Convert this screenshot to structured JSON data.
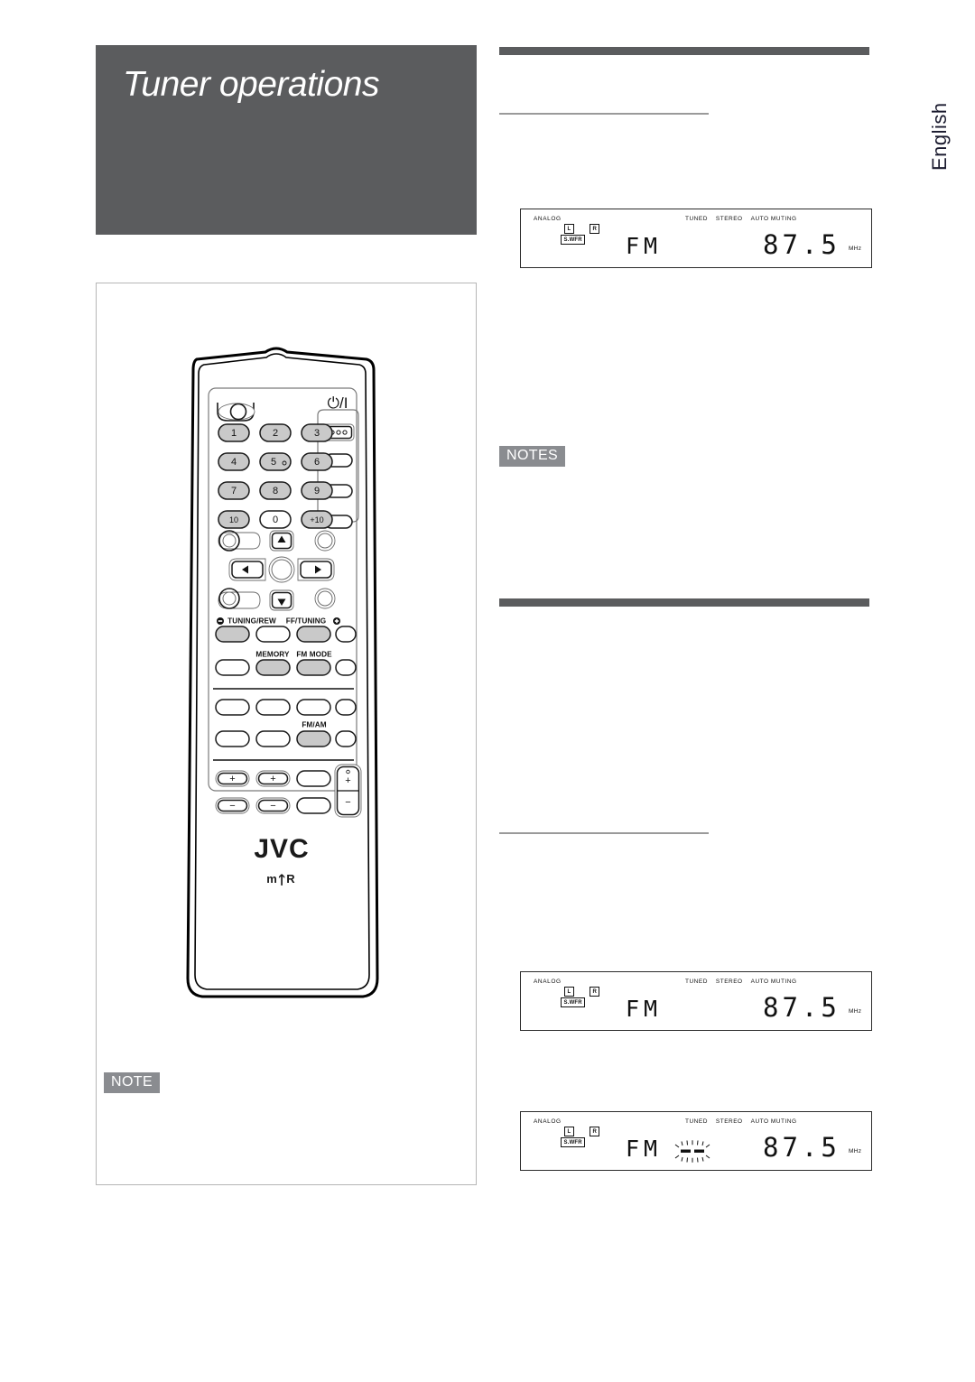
{
  "page": {
    "title": "Tuner operations",
    "language_tab": "English"
  },
  "badges": {
    "note": "NOTE",
    "notes": "NOTES"
  },
  "remote": {
    "brand": "JVC",
    "sub_brand": "mBR",
    "power_symbol": "⏻/I",
    "keypad": [
      "1",
      "2",
      "3",
      "4",
      "5",
      "6",
      "7",
      "8",
      "9",
      "10",
      "0",
      "+10"
    ],
    "labels": {
      "tuning_rew": "TUNING/REW",
      "ff_tuning": "FF/TUNING",
      "memory": "MEMORY",
      "fm_mode": "FM MODE",
      "fm_am": "FM/AM"
    },
    "volume": {
      "plus": "+",
      "minus": "−"
    },
    "nav": {
      "up": "▲",
      "down": "▼",
      "left": "◀",
      "right": "▶"
    }
  },
  "displays": [
    {
      "id": "display-tuned",
      "analog": "ANALOG",
      "channel_left": "L",
      "channel_right": "R",
      "subwoofer": "S.WFR",
      "flags": [
        "TUNED",
        "STEREO",
        "AUTO MUTING"
      ],
      "band": "FM",
      "frequency": "87.5",
      "unit": "MHz",
      "blinking_preset": false
    },
    {
      "id": "display-tuned-2",
      "analog": "ANALOG",
      "channel_left": "L",
      "channel_right": "R",
      "subwoofer": "S.WFR",
      "flags": [
        "TUNED",
        "STEREO",
        "AUTO MUTING"
      ],
      "band": "FM",
      "frequency": "87.5",
      "unit": "MHz",
      "blinking_preset": false
    },
    {
      "id": "display-preset-blinking",
      "analog": "ANALOG",
      "channel_left": "L",
      "channel_right": "R",
      "subwoofer": "S.WFR",
      "flags": [
        "TUNED",
        "STEREO",
        "AUTO MUTING"
      ],
      "band": "FM",
      "frequency": "87.5",
      "unit": "MHz",
      "blinking_preset": true
    }
  ],
  "colors": {
    "banner": "#5b5c5e",
    "badge": "#8a8c90",
    "rule_thick": "#5b5c5e",
    "rule_thin": "#9a9a9a",
    "panel_border": "#b6b6b6",
    "button_fill": "#c9c9c9"
  }
}
